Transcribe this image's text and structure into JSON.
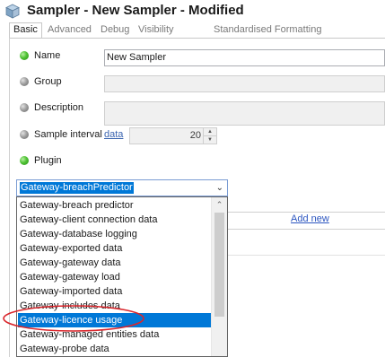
{
  "window": {
    "title": "Sampler - New Sampler - Modified",
    "icon": "cube-icon"
  },
  "tabs": [
    {
      "label": "Basic",
      "active": true
    },
    {
      "label": "Advanced"
    },
    {
      "label": "Debug"
    },
    {
      "label": "Visibility"
    },
    {
      "label": "Standardised Formatting"
    }
  ],
  "fields": {
    "name": {
      "label": "Name",
      "status": "green",
      "value": "New Sampler"
    },
    "group": {
      "label": "Group",
      "status": "grey",
      "value": ""
    },
    "description": {
      "label": "Description",
      "status": "grey",
      "value": ""
    },
    "sample_interval": {
      "label": "Sample interval",
      "status": "grey",
      "link": "data",
      "value": "20"
    },
    "plugin": {
      "label": "Plugin",
      "status": "green",
      "selected": "Gateway-breachPredictor"
    }
  },
  "background": {
    "add_new_link": "Add new"
  },
  "dropdown": {
    "items": [
      "Gateway-breach predictor",
      "Gateway-client connection data",
      "Gateway-database logging",
      "Gateway-exported data",
      "Gateway-gateway data",
      "Gateway-gateway load",
      "Gateway-imported data",
      "Gateway-includes data",
      "Gateway-licence usage",
      "Gateway-managed entities data",
      "Gateway-probe data"
    ],
    "highlighted_index": 8
  },
  "annotation": {
    "shape": "ellipse",
    "color": "#d9262c",
    "target": "Gateway-licence usage"
  },
  "colors": {
    "selection": "#0078d7",
    "link": "#2b55c0",
    "status_green": "#4fc234",
    "status_grey": "#9a9a9a"
  }
}
